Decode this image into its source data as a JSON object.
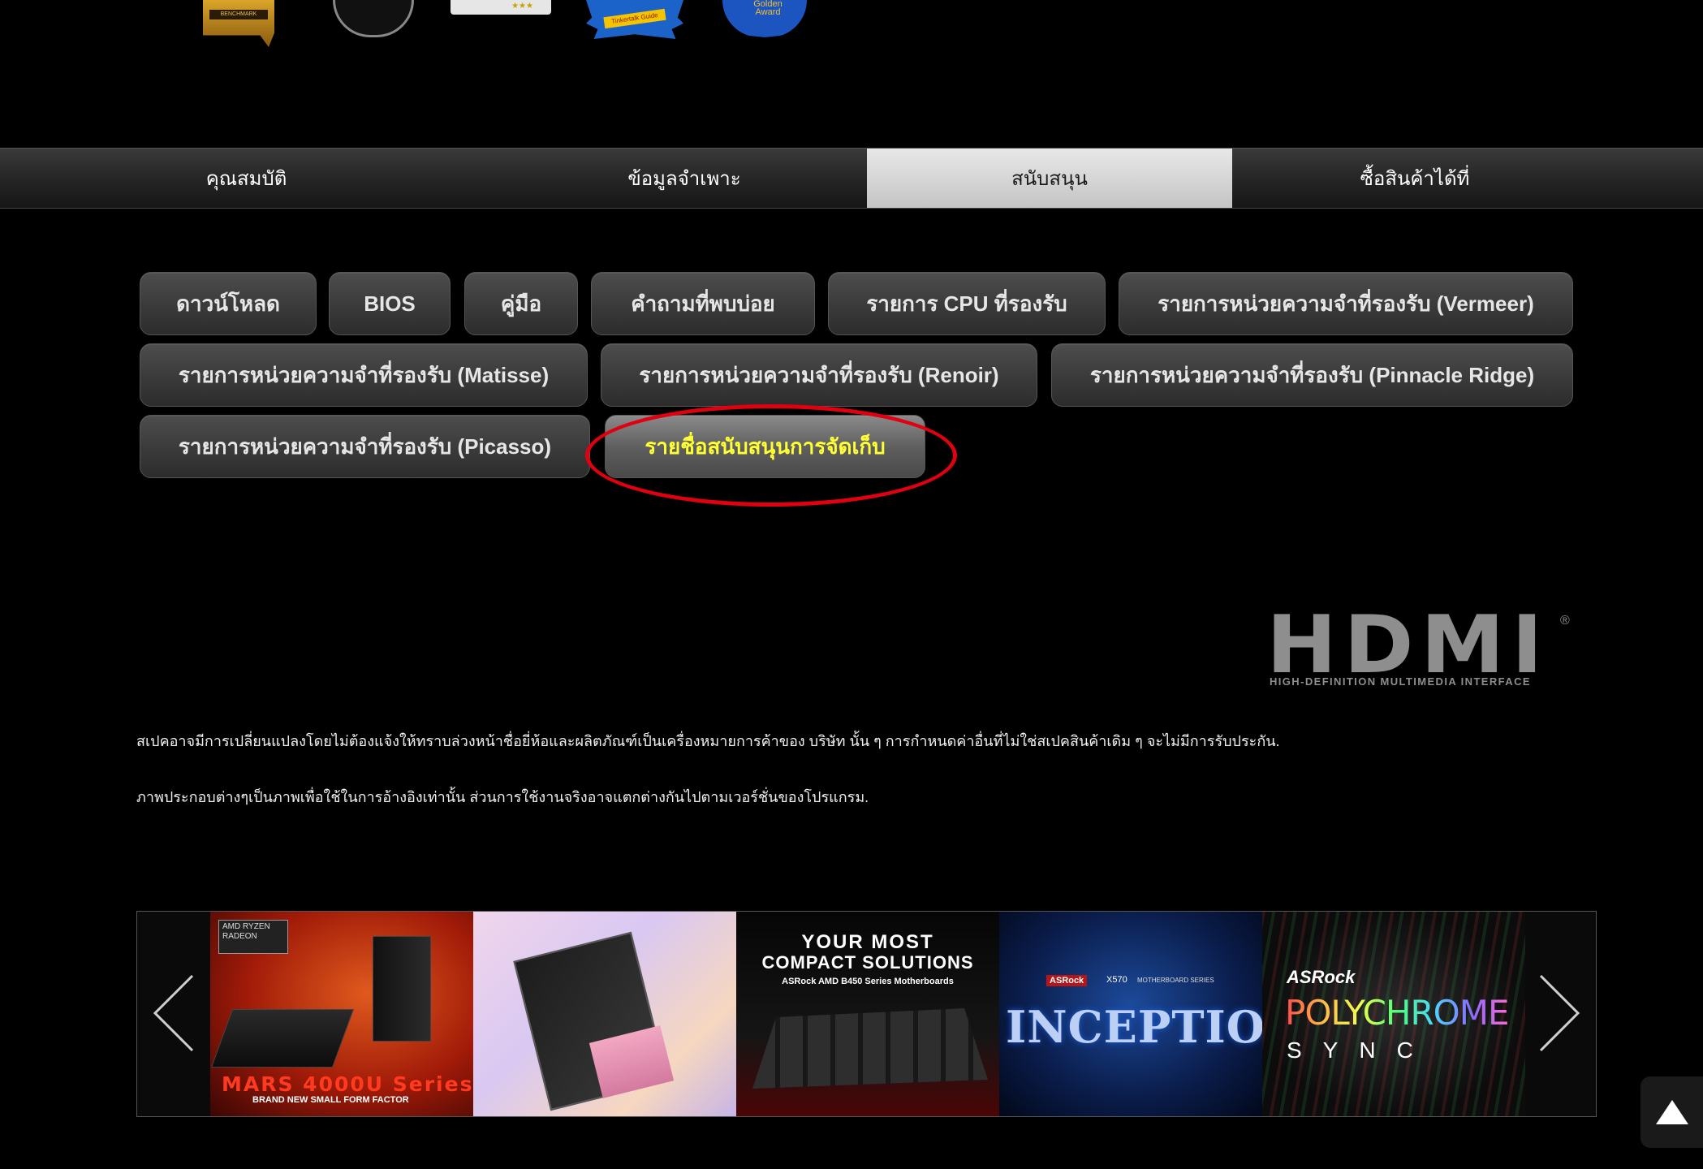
{
  "awards": {
    "benchmark_label": "BENCHMARK",
    "stars": "★★★",
    "ribbon_label": "Tinkertalk Guide",
    "golden_award": "Golden Award"
  },
  "tabs": [
    {
      "label": "คุณสมบัติ",
      "active": false
    },
    {
      "label": "ข้อมูลจำเพาะ",
      "active": false
    },
    {
      "label": "สนับสนุน",
      "active": true
    },
    {
      "label": "ซื้อสินค้าได้ที่",
      "active": false
    }
  ],
  "support_buttons": [
    {
      "label": "ดาวน์โหลด"
    },
    {
      "label": "BIOS"
    },
    {
      "label": "คู่มือ"
    },
    {
      "label": "คำถามที่พบบ่อย"
    },
    {
      "label": "รายการ CPU ที่รองรับ"
    },
    {
      "label": "รายการหน่วยความจำที่รองรับ (Vermeer)"
    },
    {
      "label": "รายการหน่วยความจำที่รองรับ (Matisse)"
    },
    {
      "label": "รายการหน่วยความจำที่รองรับ (Renoir)"
    },
    {
      "label": "รายการหน่วยความจำที่รองรับ (Pinnacle Ridge)"
    },
    {
      "label": "รายการหน่วยความจำที่รองรับ (Picasso)"
    },
    {
      "label": "รายชื่อสนับสนุนการจัดเก็บ",
      "active": true
    }
  ],
  "hdmi_logo": {
    "word": "HDMI",
    "registered": "®",
    "subtitle": "HIGH-DEFINITION MULTIMEDIA INTERFACE"
  },
  "notes": [
    "สเปคอาจมีการเปลี่ยนแปลงโดยไม่ต้องแจ้งให้ทราบล่วงหน้าชื่อยี่ห้อและผลิตภัณฑ์เป็นเครื่องหมายการค้าของ บริษัท นั้น ๆ การกำหนดค่าอื่นที่ไม่ใช่สเปคสินค้าเดิม ๆ จะไม่มีการรับประกัน.",
    "ภาพประกอบต่างๆเป็นภาพเพื่อใช้ในการอ้างอิงเท่านั้น ส่วนการใช้งานจริงอาจแตกต่างกันไปตามเวอร์ชั่นของโปรแกรม."
  ],
  "carousel": {
    "slide1": {
      "badge": "AMD RYZEN RADEON",
      "title": "MARS 4000U Series",
      "subtitle": "BRAND NEW SMALL FORM FACTOR"
    },
    "slide3": {
      "line1": "YOUR MOST",
      "line2": "COMPACT SOLUTIONS",
      "line3": "ASRock AMD B450 Series Motherboards"
    },
    "slide4": {
      "brand": "ASRock",
      "model": "X570",
      "series": "MOTHERBOARD SERIES",
      "title": "INCEPTION"
    },
    "slide5": {
      "brand": "ASRock",
      "title": "POLYCHROME",
      "subtitle": "SYNC"
    }
  },
  "colors": {
    "active_tab_bg": "#d9d9d9",
    "active_button_text": "#ffff33",
    "highlight_ellipse": "#e00010"
  }
}
